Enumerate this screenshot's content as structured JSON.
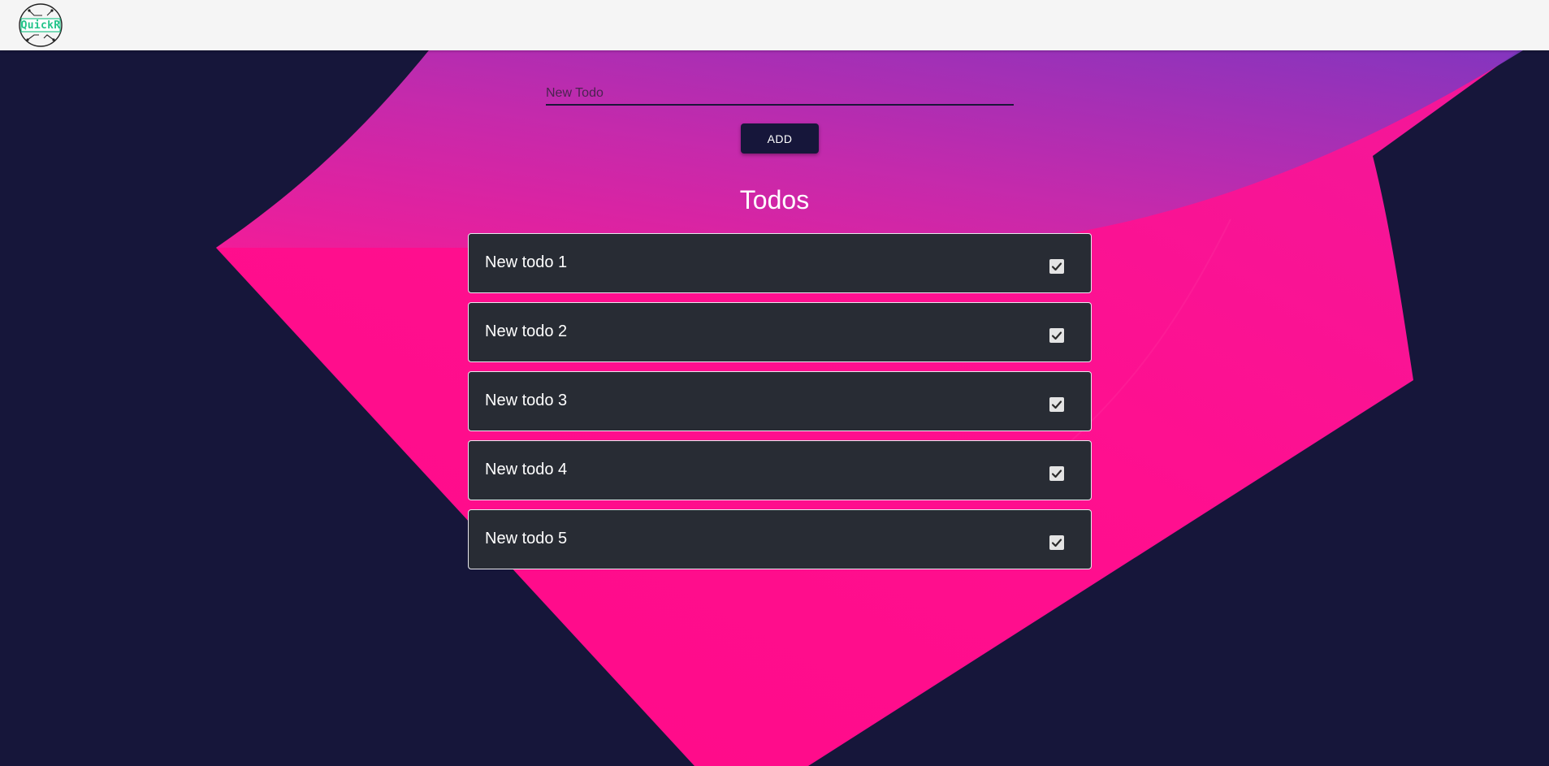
{
  "app": {
    "logo_text": "QuickR"
  },
  "form": {
    "input_placeholder": "New Todo",
    "input_value": "",
    "add_label": "ADD"
  },
  "list": {
    "title": "Todos",
    "items": [
      {
        "label": "New todo 1",
        "checked": true
      },
      {
        "label": "New todo 2",
        "checked": true
      },
      {
        "label": "New todo 3",
        "checked": true
      },
      {
        "label": "New todo 4",
        "checked": true
      },
      {
        "label": "New todo 5",
        "checked": true
      }
    ]
  },
  "colors": {
    "background": "#16163a",
    "accent_pink": "#ff0f8f",
    "accent_purple": "#7a38c2",
    "card": "#282c34",
    "topbar": "#f5f5f5",
    "logo_green": "#23c48a"
  },
  "icons": {
    "logo": "circuit-globe-icon",
    "checkbox": "checkmark-icon"
  }
}
